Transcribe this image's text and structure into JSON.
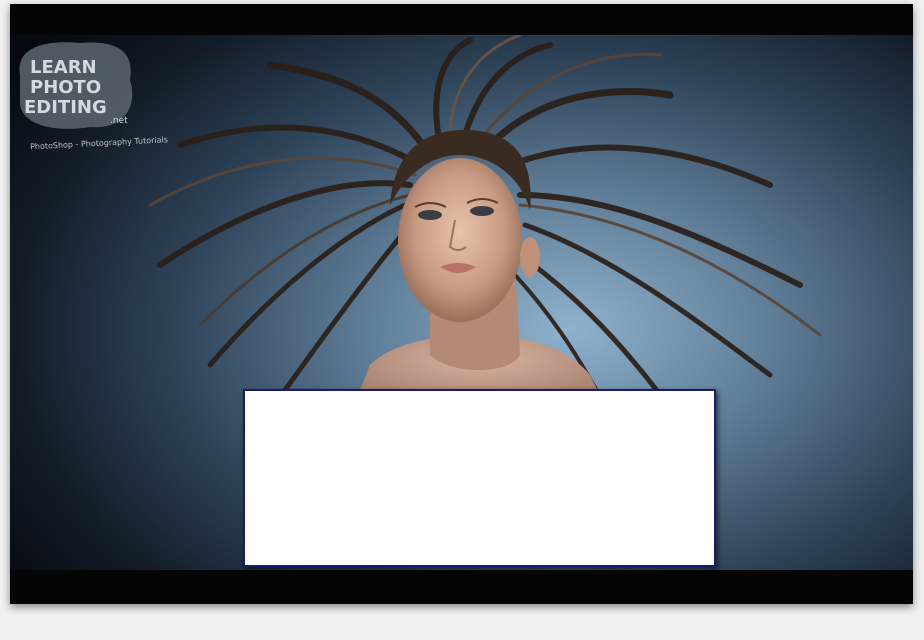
{
  "photo": {
    "description_icon": "woman-windblown-hair-portrait",
    "background_colors": [
      "#8fb2cc",
      "#2f4459",
      "#060a10"
    ]
  },
  "logo": {
    "line1": "LEARN",
    "line2": "PHOTO",
    "line3": "EDITING",
    "suffix": ".net",
    "tagline": "PhotoShop - Photography Tutorials"
  },
  "overlay": {
    "fill": "#ffffff",
    "border": "#1a1a6e"
  }
}
